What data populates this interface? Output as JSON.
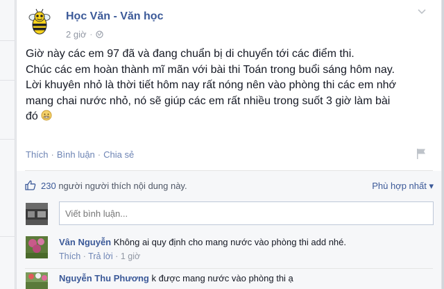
{
  "post": {
    "page_name": "Học Văn - Văn học",
    "time": "2 giờ",
    "meta_sep": "·",
    "text_lines": [
      "Giờ này các em 97 đã và đang chuẩn bị di chuyển tới các điểm thi.",
      "Chúc các em hoàn thành mĩ mãn với bài thi Toán trong buổi sáng hôm nay.",
      "Lời khuyên nhỏ là thời tiết hôm nay rất nóng nên vào phòng thi các em nhớ",
      "mang chai nước nhỏ, nó sẽ giúp các em rất nhiều trong suốt 3 giờ làm bài",
      "đó"
    ],
    "actions": {
      "like": "Thích",
      "comment": "Bình luận",
      "share": "Chia sẻ",
      "sep": "·"
    }
  },
  "likes": {
    "count": "230",
    "text": " người người thích nội dung này.",
    "sort_label": "Phù hợp nhất ▾"
  },
  "composer": {
    "placeholder": "Viết bình luận..."
  },
  "comments": [
    {
      "author": "Vân Nguyễn",
      "text": "Không ai quy định cho mang nước vào phòng thi add nhé.",
      "like": "Thích",
      "reply": "Trả lời",
      "time": "1 giờ",
      "sep": "·"
    },
    {
      "author": "Nguyễn Thu Phương",
      "text": "k được mang nước vào phòng thi ạ"
    }
  ],
  "icons": {
    "avatar": "bee-logo-icon",
    "globe": "globe-icon",
    "chevron": "chevron-down-icon",
    "flag": "flag-icon",
    "like": "thumbs-up-icon",
    "emoji": "smiley-icon"
  },
  "colors": {
    "link": "#3b5998",
    "muted": "#9197a3",
    "action": "#6d84b4",
    "background": "#f6f7f9"
  }
}
